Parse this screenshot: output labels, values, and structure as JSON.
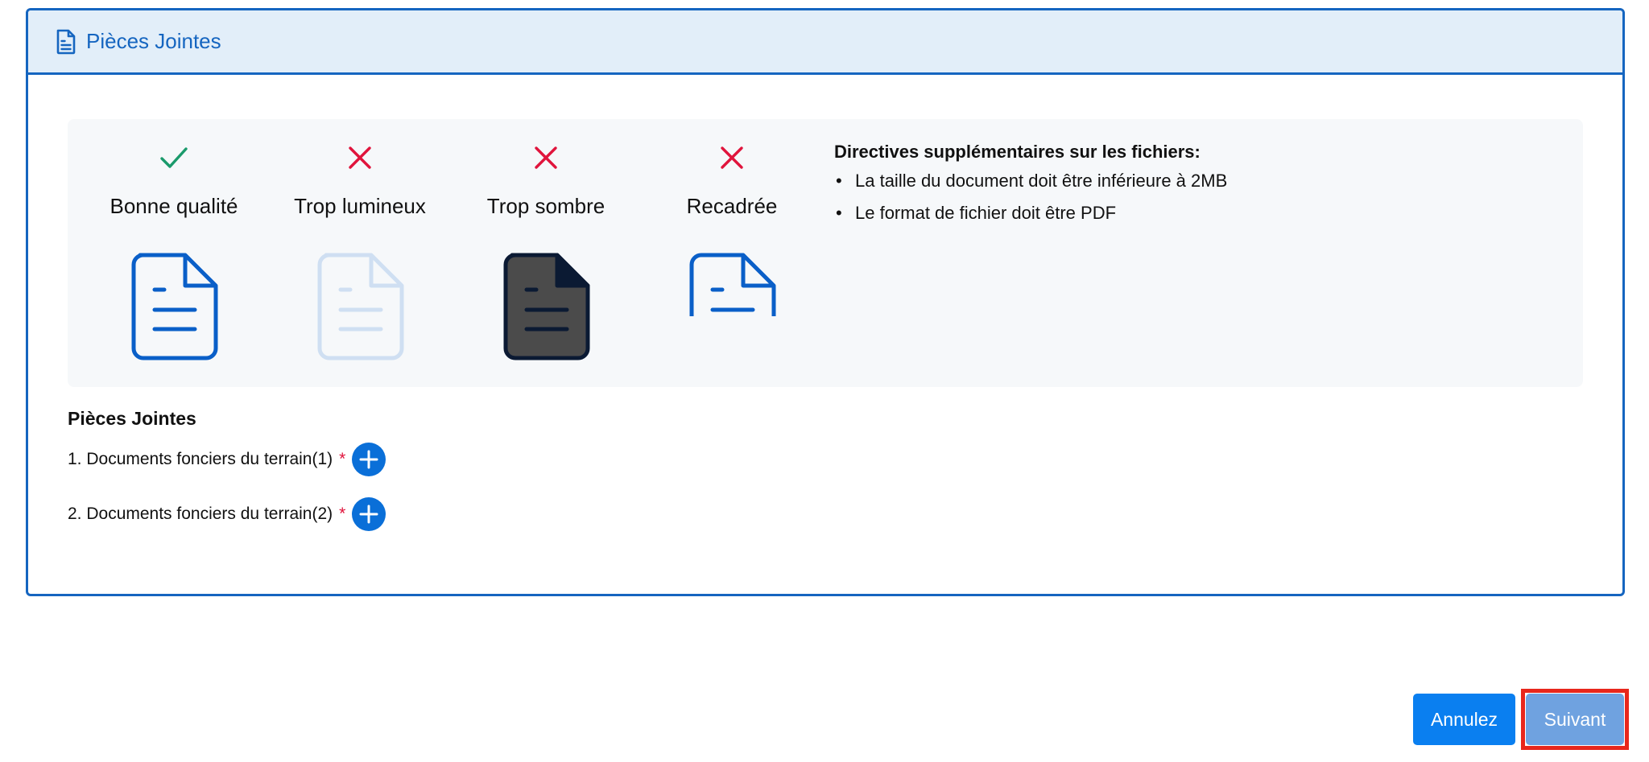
{
  "panel": {
    "title": "Pièces Jointes",
    "icon": "document-icon"
  },
  "quality_guide": {
    "items": [
      {
        "label": "Bonne qualité",
        "status": "good",
        "status_icon": "check-icon"
      },
      {
        "label": "Trop lumineux",
        "status": "bad",
        "status_icon": "cross-icon"
      },
      {
        "label": "Trop sombre",
        "status": "bad",
        "status_icon": "cross-icon"
      },
      {
        "label": "Recadrée",
        "status": "bad",
        "status_icon": "cross-icon"
      }
    ],
    "directives": {
      "title": "Directives supplémentaires sur les fichiers:",
      "bullets": [
        "La taille du document doit être inférieure à 2MB",
        "Le format de fichier doit être PDF"
      ]
    }
  },
  "attachments": {
    "title": "Pièces Jointes",
    "items": [
      {
        "label": "1. Documents fonciers du terrain(1)",
        "required": "*"
      },
      {
        "label": "2. Documents fonciers du terrain(2)",
        "required": "*"
      }
    ]
  },
  "actions": {
    "cancel": "Annulez",
    "next": "Suivant"
  },
  "colors": {
    "primary": "#1565c0",
    "header_bg": "#e2eef9",
    "success": "#1a9a6b",
    "error": "#e0143c",
    "highlight": "#e8271c"
  }
}
